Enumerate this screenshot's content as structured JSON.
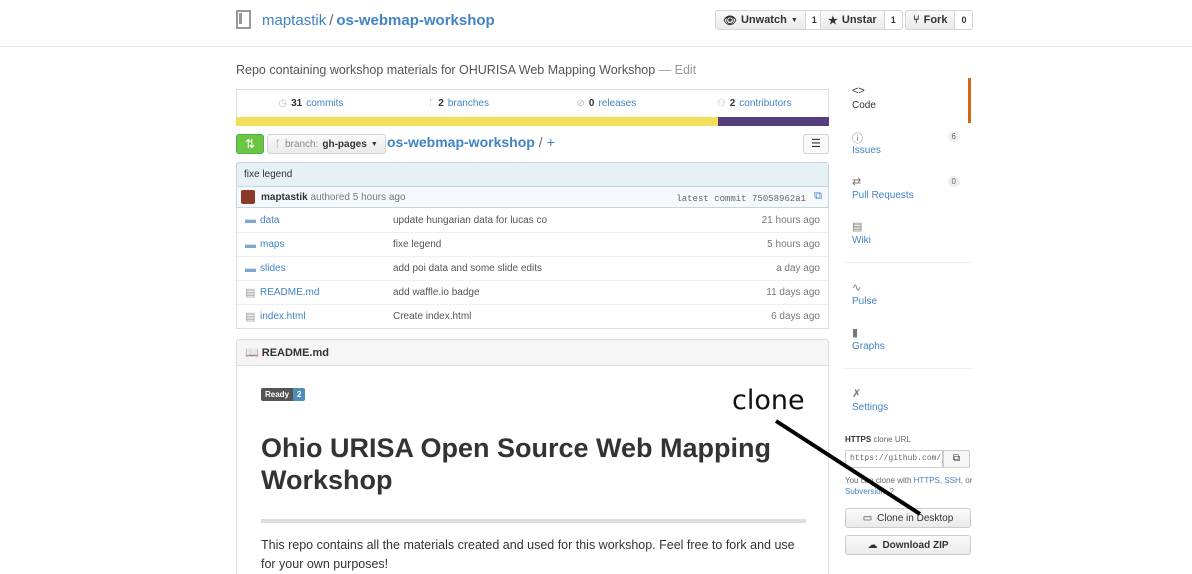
{
  "header": {
    "owner": "maptastik",
    "separator": "/",
    "repo": "os-webmap-workshop",
    "watch_label": "Unwatch",
    "watch_count": "1",
    "star_label": "Unstar",
    "star_count": "1",
    "fork_label": "Fork",
    "fork_count": "0"
  },
  "description": {
    "text": "Repo containing workshop materials for OHURISA Web Mapping Workshop",
    "edit": "— Edit"
  },
  "stats": {
    "commits_count": "31",
    "commits_label": "commits",
    "branches_count": "2",
    "branches_label": "branches",
    "releases_count": "0",
    "releases_label": "releases",
    "contributors_count": "2",
    "contributors_label": "contributors"
  },
  "languages": {
    "primary_color": "#f1e05a",
    "secondary_color": "#563d7c"
  },
  "branch": {
    "prefix": "branch:",
    "name": "gh-pages",
    "path_repo": "os-webmap-workshop",
    "path_sep": "/",
    "path_add": "+"
  },
  "commit": {
    "message": "fixe legend",
    "author": "maptastik",
    "authored": "authored 5 hours ago",
    "latest_label": "latest commit",
    "sha": "75058962a1"
  },
  "files": [
    {
      "icon": "folder-icon",
      "name": "data",
      "message": "update hungarian data for lucas co",
      "age": "21 hours ago"
    },
    {
      "icon": "folder-icon",
      "name": "maps",
      "message": "fixe legend",
      "age": "5 hours ago"
    },
    {
      "icon": "folder-icon",
      "name": "slides",
      "message": "add poi data and some slide edits",
      "age": "a day ago"
    },
    {
      "icon": "file-icon",
      "name": "README.md",
      "message": "add waffle.io badge",
      "age": "11 days ago"
    },
    {
      "icon": "file-icon",
      "name": "index.html",
      "message": "Create index.html",
      "age": "6 days ago"
    }
  ],
  "readme": {
    "header": "README.md",
    "badge_left": "Ready",
    "badge_right": "2",
    "title": "Ohio URISA Open Source Web Mapping Workshop",
    "text": "This repo contains all the materials created and used for this workshop. Feel free to fork and use for your own purposes!"
  },
  "sidenav": {
    "code": "Code",
    "issues": "Issues",
    "issues_count": "6",
    "pull_requests": "Pull Requests",
    "pull_requests_count": "0",
    "wiki": "Wiki",
    "pulse": "Pulse",
    "graphs": "Graphs",
    "settings": "Settings"
  },
  "clone": {
    "protocol": "HTTPS",
    "title_rest": "clone URL",
    "url": "https://github.com/",
    "help_prefix": "You can clone with",
    "https": "HTTPS",
    "ssh": "SSH",
    "or": "or",
    "subversion": "Subversion",
    "desktop_button": "Clone in Desktop",
    "zip_button": "Download ZIP"
  },
  "annotation": {
    "text": "clone"
  }
}
